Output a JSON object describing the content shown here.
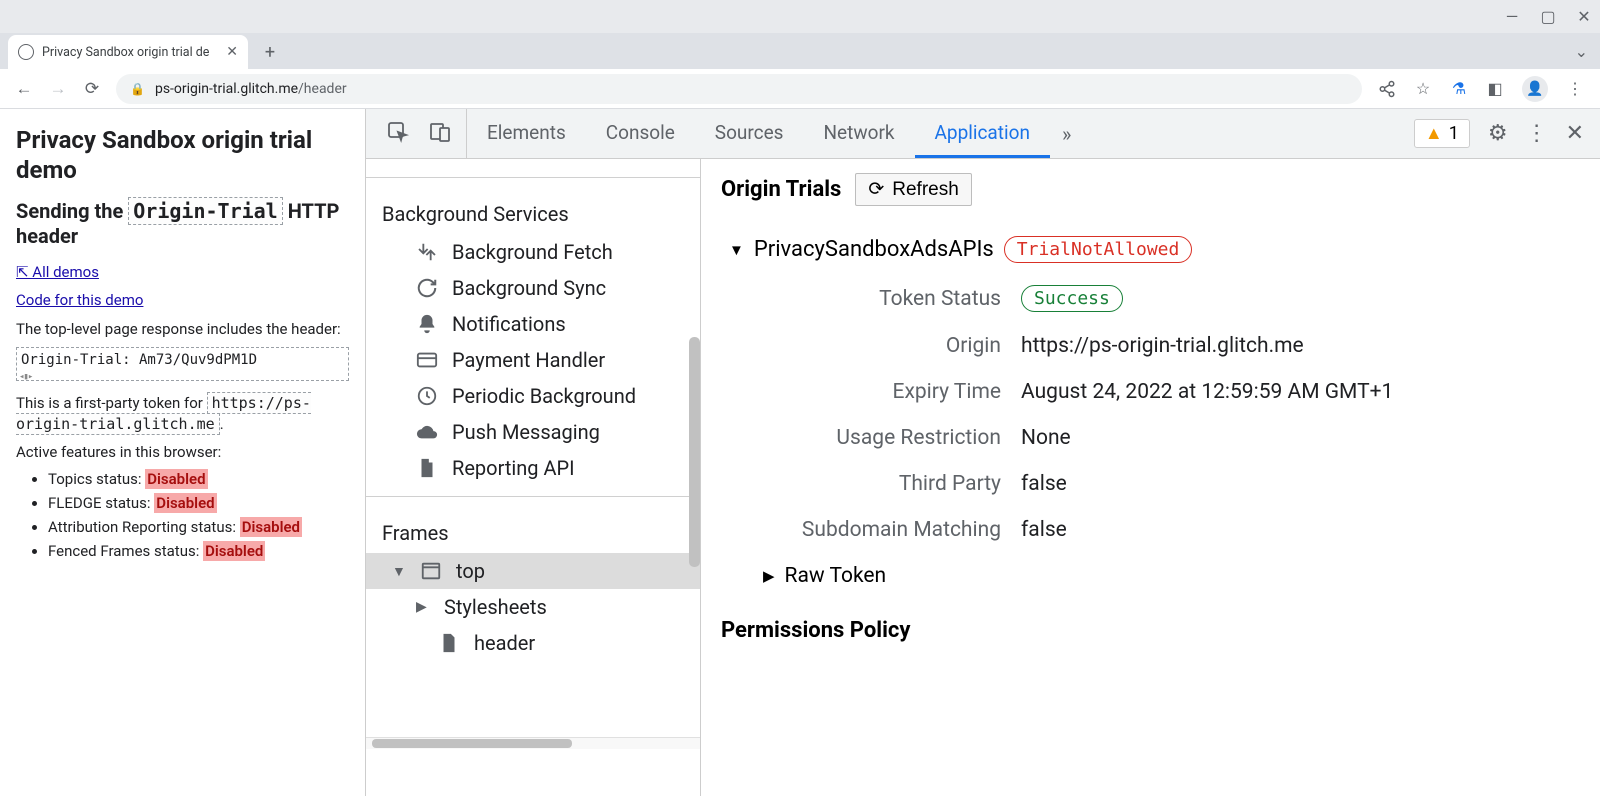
{
  "window": {
    "tab_title": "Privacy Sandbox origin trial de"
  },
  "omnibox": {
    "host": "ps-origin-trial.glitch.me",
    "path": "/header"
  },
  "page": {
    "h1": "Privacy Sandbox origin trial demo",
    "h2_pre": "Sending the ",
    "h2_code": "Origin-Trial",
    "h2_post": " HTTP header",
    "link_all": "⇱ All demos",
    "link_code": "Code for this demo",
    "p1": "The top-level page response includes the header:",
    "code_block": "Origin-Trial: Am73/Quv9dPM1D",
    "p2_pre": "This is a first-party token for ",
    "p2_code": "https://ps-origin-trial.glitch.me",
    "p3": "Active features in this browser:",
    "features": {
      "f0_label": "Topics status: ",
      "f0_status": "Disabled",
      "f1_label": "FLEDGE status: ",
      "f1_status": "Disabled",
      "f2_label": "Attribution Reporting status: ",
      "f2_status": "Disabled",
      "f3_label": "Fenced Frames status: ",
      "f3_status": "Disabled"
    }
  },
  "devtools": {
    "tabs": {
      "t0": "Elements",
      "t1": "Console",
      "t2": "Sources",
      "t3": "Network",
      "t4": "Application"
    },
    "issues_count": "1",
    "sidebar": {
      "section1": "Background Services",
      "items": {
        "i0": "Background Fetch",
        "i1": "Background Sync",
        "i2": "Notifications",
        "i3": "Payment Handler",
        "i4": "Periodic Background",
        "i5": "Push Messaging",
        "i6": "Reporting API"
      },
      "section2": "Frames",
      "tree": {
        "top": "top",
        "stylesheets": "Stylesheets",
        "header": "header"
      }
    },
    "main": {
      "title": "Origin Trials",
      "refresh": "Refresh",
      "trial_name": "PrivacySandboxAdsAPIs",
      "trial_status": "TrialNotAllowed",
      "rows": {
        "r0_label": "Token Status",
        "r0_value": "Success",
        "r1_label": "Origin",
        "r1_value": "https://ps-origin-trial.glitch.me",
        "r2_label": "Expiry Time",
        "r2_value": "August 24, 2022 at 12:59:59 AM GMT+1",
        "r3_label": "Usage Restriction",
        "r3_value": "None",
        "r4_label": "Third Party",
        "r4_value": "false",
        "r5_label": "Subdomain Matching",
        "r5_value": "false"
      },
      "raw_token": "Raw Token",
      "permissions": "Permissions Policy"
    }
  }
}
